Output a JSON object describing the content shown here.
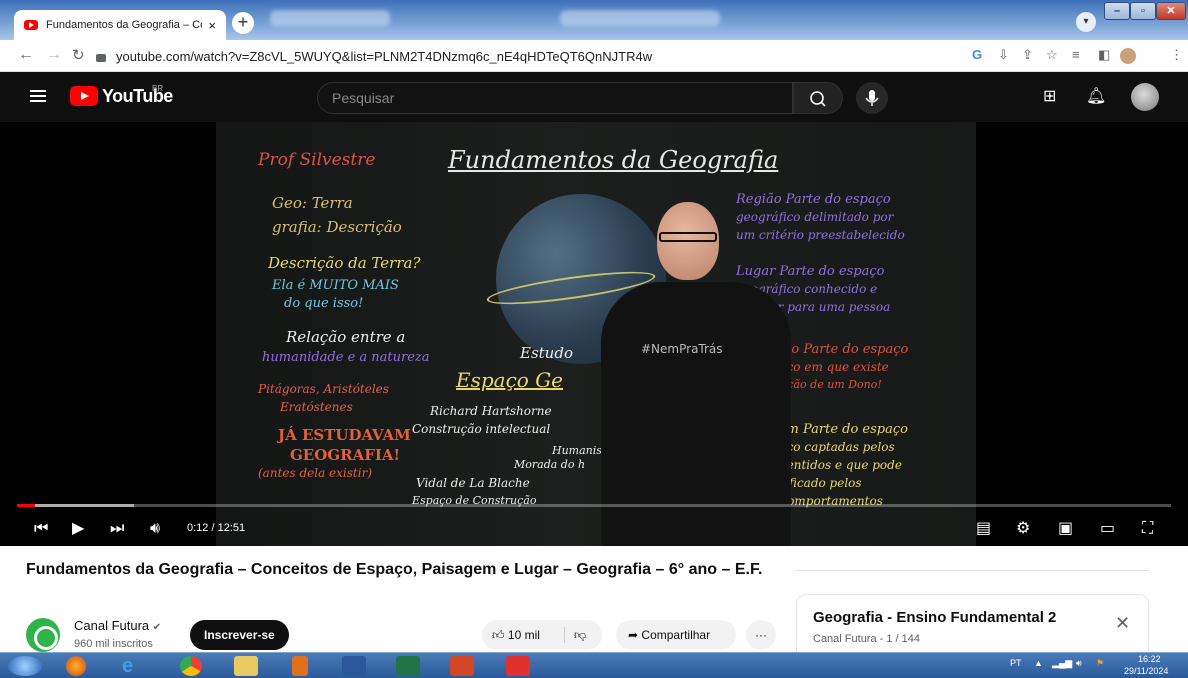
{
  "browser": {
    "tab_title": "Fundamentos da Geografia – Cor",
    "tab_close": "×",
    "new_tab": "+",
    "url": "youtube.com/watch?v=Z8cVL_5WUYQ&list=PLNM2T4DNzmq6c_nE4qHDTeQT6QnNJTR4w",
    "window_minimize": "–",
    "window_maximize": "▫",
    "window_close": "✕"
  },
  "youtube": {
    "logo_text": "YouTube",
    "country_code": "BR",
    "search_placeholder": "Pesquisar"
  },
  "video": {
    "current_time": "0:12",
    "duration": "12:51",
    "time_display": "0:12 / 12:51",
    "progress_fraction": 0.0156,
    "chalkboard": {
      "title": "Fundamentos da Geografia",
      "teacher": "Prof Silvestre",
      "left": [
        "Geo: Terra",
        "grafia: Descrição",
        "Descrição da Terra?",
        "Ela é MUITO MAIS",
        "do que isso!",
        "Relação entre a",
        "humanidade e a natureza",
        "Pitágoras, Aristóteles",
        "Eratóstenes",
        "JÁ ESTUDAVAM",
        "GEOGRAFIA!",
        "(antes dela existir)"
      ],
      "center": [
        "Estudo",
        "Espaço Ge",
        "Richard Hartshorne",
        "Construção intelectual",
        "Humanis",
        "Morada do h",
        "Vidal de La Blache",
        "Espaço de Construção"
      ],
      "right": [
        "Região Parte do espaço",
        "geográfico delimitado por",
        "um critério preestabelecido",
        "Lugar Parte do espaço",
        "geográfico conhecido e",
        "familiar para uma pessoa",
        "Território Parte do espaço",
        "geográfico em que existe",
        "a dominação de um Dono!",
        "Paisagem Parte do espaço",
        "geográfico captadas pelos",
        "nossos sentidos e que pode",
        "ser modificado pelos",
        "nossos comportamentos"
      ],
      "shirt_text": "#NemPraTrás"
    }
  },
  "details": {
    "title": "Fundamentos da Geografia – Conceitos de Espaço, Paisagem e Lugar – Geografia – 6° ano – E.F.",
    "channel_name": "Canal Futura",
    "verified_mark": "✔",
    "subscribers": "960 mil inscritos",
    "subscribe_label": "Inscrever-se",
    "likes": "10 mil",
    "share_label": "Compartilhar",
    "more_label": "···"
  },
  "playlist": {
    "title": "Geografia - Ensino Fundamental 2",
    "subtitle": "Canal Futura - 1 / 144",
    "close": "✕"
  },
  "taskbar": {
    "language": "PT",
    "time": "16:22",
    "date": "29/11/2024"
  },
  "colors": {
    "youtube_red": "#ff0000",
    "yt_dark": "#0f0f0f",
    "taskbar_blue": "#2a5a99"
  }
}
